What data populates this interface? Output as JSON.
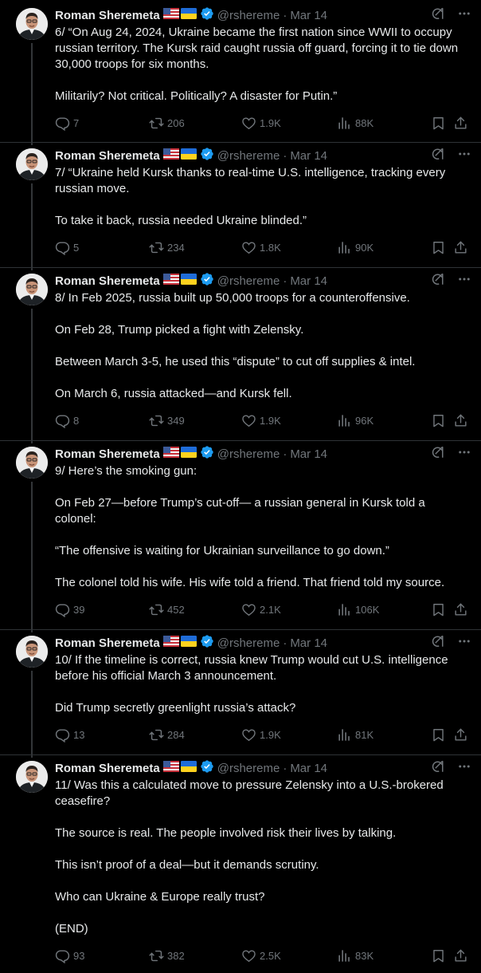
{
  "tweets": [
    {
      "name": "Roman Sheremeta",
      "handle": "@rshereme",
      "time": "Mar 14",
      "paragraphs": [
        "6/ “On Aug 24, 2024, Ukraine became the first nation since WWII to occupy russian territory. The Kursk raid caught russia off guard, forcing it to tie down 30,000 troops for six months.",
        "Militarily? Not critical. Politically? A disaster for Putin.”"
      ],
      "replies": "7",
      "reposts": "206",
      "likes": "1.9K",
      "views": "88K"
    },
    {
      "name": "Roman Sheremeta",
      "handle": "@rshereme",
      "time": "Mar 14",
      "paragraphs": [
        "7/ “Ukraine held Kursk thanks to real-time U.S. intelligence, tracking every russian move.",
        "To take it back, russia needed Ukraine blinded.”"
      ],
      "replies": "5",
      "reposts": "234",
      "likes": "1.8K",
      "views": "90K"
    },
    {
      "name": "Roman Sheremeta",
      "handle": "@rshereme",
      "time": "Mar 14",
      "paragraphs": [
        "8/ In Feb 2025, russia built up 50,000 troops for a counteroffensive.",
        "On Feb 28, Trump picked a fight with Zelensky.",
        "Between March 3-5, he used this “dispute” to cut off supplies & intel.",
        "On March 6, russia attacked—and Kursk fell."
      ],
      "replies": "8",
      "reposts": "349",
      "likes": "1.9K",
      "views": "96K"
    },
    {
      "name": "Roman Sheremeta",
      "handle": "@rshereme",
      "time": "Mar 14",
      "paragraphs": [
        "9/ Here’s the smoking gun:",
        "On Feb 27—before Trump’s cut-off— a russian general in Kursk told a colonel:",
        "“The offensive is waiting for Ukrainian surveillance to go down.”",
        "The colonel told his wife. His wife told a friend. That friend told my source."
      ],
      "replies": "39",
      "reposts": "452",
      "likes": "2.1K",
      "views": "106K"
    },
    {
      "name": "Roman Sheremeta",
      "handle": "@rshereme",
      "time": "Mar 14",
      "paragraphs": [
        "10/ If the timeline is correct, russia knew Trump would cut U.S. intelligence before his official March 3 announcement.",
        "Did Trump secretly greenlight russia’s attack?"
      ],
      "replies": "13",
      "reposts": "284",
      "likes": "1.9K",
      "views": "81K"
    },
    {
      "name": "Roman Sheremeta",
      "handle": "@rshereme",
      "time": "Mar 14",
      "paragraphs": [
        "11/ Was this a calculated move to pressure Zelensky into a U.S.-brokered ceasefire?",
        "The source is real. The people involved risk their lives by talking.",
        "This isn’t proof of a deal—but it demands scrutiny.",
        "Who can Ukraine & Europe really trust?",
        "(END)"
      ],
      "replies": "93",
      "reposts": "382",
      "likes": "2.5K",
      "views": "83K"
    }
  ],
  "icons": {
    "verified": "verified-badge-icon",
    "flag_us": "us-flag-icon",
    "flag_ua": "ukraine-flag-icon",
    "grok": "grok-icon",
    "more": "more-icon",
    "reply": "reply-icon",
    "repost": "repost-icon",
    "like": "heart-icon",
    "views": "views-icon",
    "bookmark": "bookmark-icon",
    "share": "share-icon"
  },
  "colors": {
    "background": "#000000",
    "text": "#e7e9ea",
    "muted": "#71767b",
    "verified": "#1d9bf0",
    "divider": "#2f3336"
  }
}
